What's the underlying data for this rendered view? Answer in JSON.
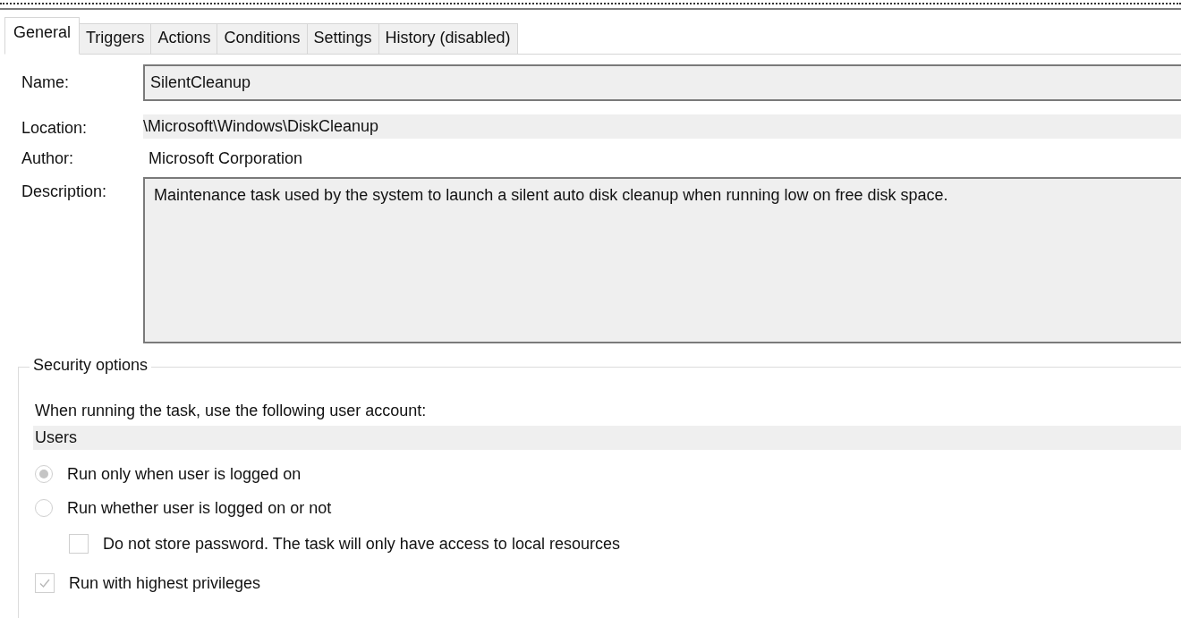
{
  "tabs": [
    {
      "label": "General",
      "selected": true
    },
    {
      "label": "Triggers",
      "selected": false
    },
    {
      "label": "Actions",
      "selected": false
    },
    {
      "label": "Conditions",
      "selected": false
    },
    {
      "label": "Settings",
      "selected": false
    },
    {
      "label": "History (disabled)",
      "selected": false
    }
  ],
  "general": {
    "fields": [
      {
        "kind": "textbox",
        "label": "Name:",
        "value": "SilentCleanup"
      },
      {
        "kind": "readonly",
        "label": "Location:",
        "value": "\\Microsoft\\Windows\\DiskCleanup"
      },
      {
        "kind": "plain",
        "label": "Author:",
        "value": "Microsoft Corporation"
      },
      {
        "kind": "textarea",
        "label": "Description:",
        "value": "Maintenance task used by the system to launch a silent auto disk cleanup when running low on free disk space."
      }
    ],
    "security_options": {
      "title": "Security options",
      "prompt": "When running the task, use the following user account:",
      "user_account": "Users",
      "options": [
        {
          "kind": "radio",
          "label": "Run only when user is logged on",
          "selected": true,
          "disabled": true
        },
        {
          "kind": "radio",
          "label": "Run whether user is logged on or not",
          "selected": false,
          "disabled": true
        },
        {
          "kind": "subcheckbox",
          "label": "Do not store password.  The task will only have access to local resources",
          "checked": false,
          "disabled": true
        },
        {
          "kind": "checkbox",
          "label": "Run with highest privileges",
          "checked": true,
          "disabled": true
        }
      ]
    }
  }
}
